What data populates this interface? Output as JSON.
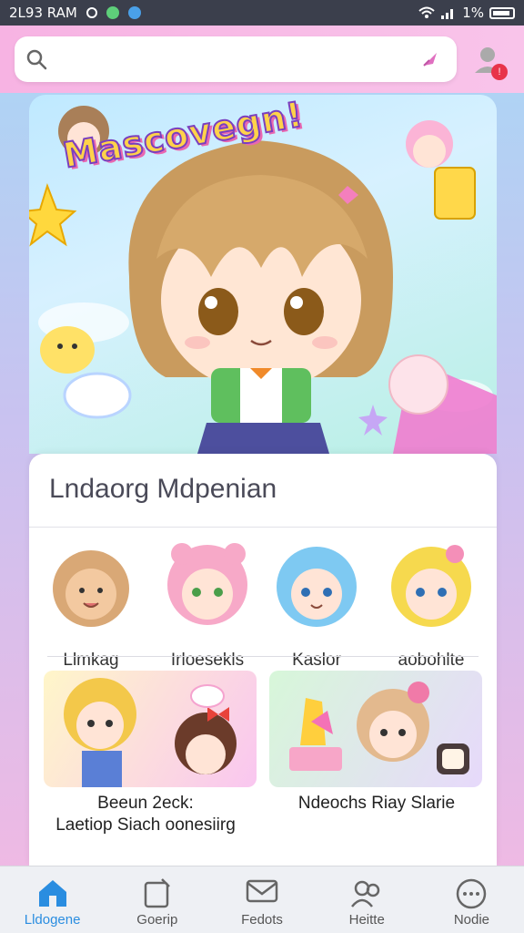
{
  "status_bar": {
    "time": "2L93 RAM",
    "battery_text": "1%"
  },
  "search": {
    "value": "",
    "placeholder": "",
    "notification_badge": "!"
  },
  "hero": {
    "title": "Mascovegn!"
  },
  "card": {
    "title": "Lndaorg Mdpenian",
    "characters": [
      {
        "name": "Llmkag"
      },
      {
        "name": "Irloesekls"
      },
      {
        "name": "Kaslor"
      },
      {
        "name": "aobohlte"
      }
    ],
    "tiles": [
      {
        "line1": "Beeun          2eck:",
        "line2": "Laetiop Siach  oonesiirg"
      },
      {
        "line1": "Ndeochs     Riay Slarie",
        "line2": ""
      }
    ]
  },
  "nav": {
    "items": [
      {
        "label": "Lldogene",
        "active": true
      },
      {
        "label": "Goerip",
        "active": false
      },
      {
        "label": "Fedots",
        "active": false
      },
      {
        "label": "Heitte",
        "active": false
      },
      {
        "label": "Nodie",
        "active": false
      }
    ]
  },
  "colors": {
    "accent": "#2a8de0",
    "top_bar": "#f7b3e3",
    "badge": "#e8334a"
  }
}
